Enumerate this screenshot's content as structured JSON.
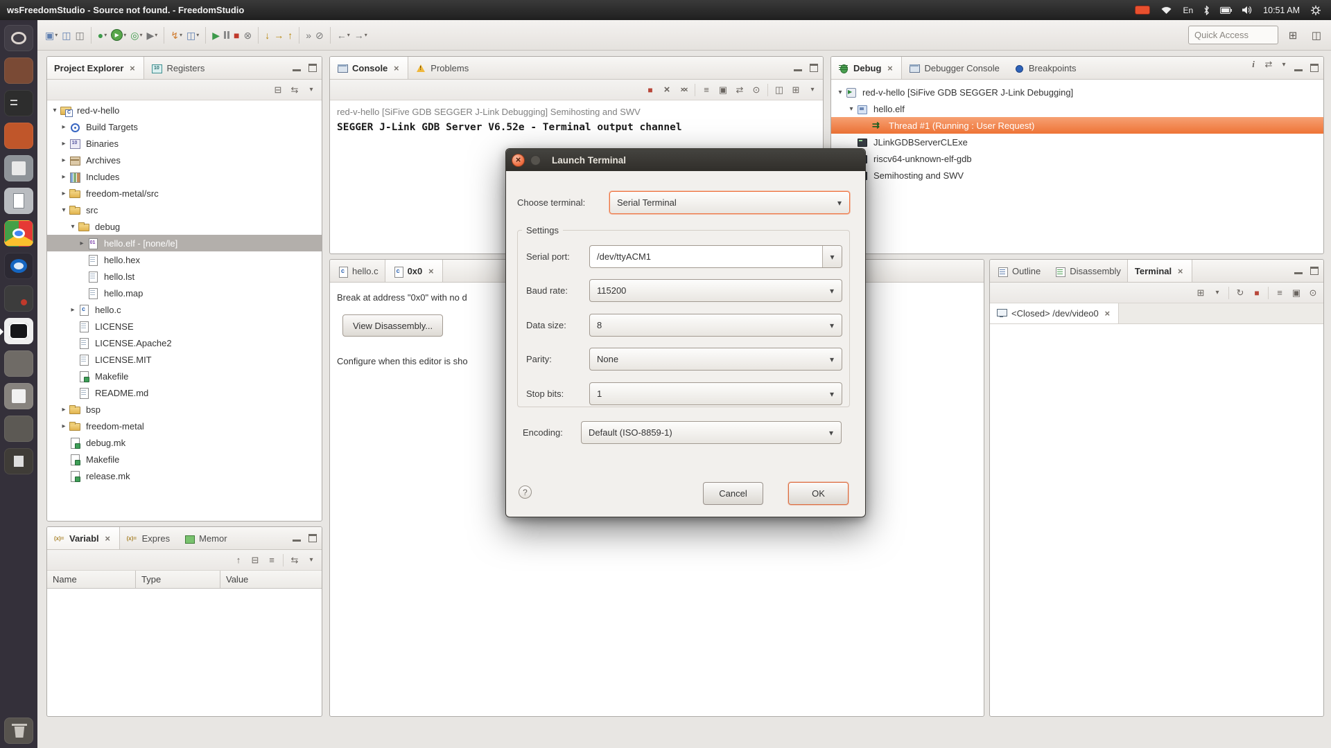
{
  "topbar": {
    "title": "wsFreedomStudio - Source not found. - FreedomStudio",
    "keyboard_indicator": "En",
    "clock": "10:51 AM"
  },
  "toolbar": {
    "quick_access_placeholder": "Quick Access"
  },
  "project_explorer": {
    "tabs": [
      {
        "label": "Project Explorer"
      },
      {
        "label": "Registers"
      }
    ],
    "tree": [
      {
        "label": "red-v-hello",
        "level": 0,
        "icon": "c-project",
        "expanded": true
      },
      {
        "label": "Build Targets",
        "level": 1,
        "icon": "build-targets",
        "expanded": false
      },
      {
        "label": "Binaries",
        "level": 1,
        "icon": "binaries",
        "expanded": false
      },
      {
        "label": "Archives",
        "level": 1,
        "icon": "archives",
        "expanded": false
      },
      {
        "label": "Includes",
        "level": 1,
        "icon": "includes",
        "expanded": false
      },
      {
        "label": "freedom-metal/src",
        "level": 1,
        "icon": "folder",
        "expanded": false
      },
      {
        "label": "src",
        "level": 1,
        "icon": "folder",
        "expanded": true
      },
      {
        "label": "debug",
        "level": 2,
        "icon": "folder",
        "expanded": true
      },
      {
        "label": "hello.elf - [none/le]",
        "level": 3,
        "icon": "elf-binary",
        "selected": true
      },
      {
        "label": "hello.hex",
        "level": 3,
        "icon": "file"
      },
      {
        "label": "hello.lst",
        "level": 3,
        "icon": "file"
      },
      {
        "label": "hello.map",
        "level": 3,
        "icon": "file"
      },
      {
        "label": "hello.c",
        "level": 2,
        "icon": "c-file",
        "expanded": false
      },
      {
        "label": "LICENSE",
        "level": 2,
        "icon": "file"
      },
      {
        "label": "LICENSE.Apache2",
        "level": 2,
        "icon": "file"
      },
      {
        "label": "LICENSE.MIT",
        "level": 2,
        "icon": "file"
      },
      {
        "label": "Makefile",
        "level": 2,
        "icon": "makefile"
      },
      {
        "label": "README.md",
        "level": 2,
        "icon": "file"
      },
      {
        "label": "bsp",
        "level": 1,
        "icon": "folder",
        "expanded": false
      },
      {
        "label": "freedom-metal",
        "level": 1,
        "icon": "folder",
        "expanded": false
      },
      {
        "label": "debug.mk",
        "level": 1,
        "icon": "makefile"
      },
      {
        "label": "Makefile",
        "level": 1,
        "icon": "makefile"
      },
      {
        "label": "release.mk",
        "level": 1,
        "icon": "makefile"
      }
    ]
  },
  "variables": {
    "tabs": [
      {
        "label": "Variabl"
      },
      {
        "label": "Expres"
      },
      {
        "label": "Memor"
      }
    ],
    "columns": [
      "Name",
      "Type",
      "Value"
    ]
  },
  "console": {
    "tabs": [
      {
        "label": "Console"
      },
      {
        "label": "Problems"
      }
    ],
    "header_line": "red-v-hello [SiFive GDB SEGGER J-Link Debugging] Semihosting and SWV",
    "output_line": "SEGGER J-Link GDB Server V6.52e - Terminal output channel"
  },
  "editor": {
    "tabs": [
      {
        "label": "hello.c"
      },
      {
        "label": "0x0"
      }
    ],
    "message": "Break at address \"0x0\" with no d",
    "disassembly_button": "View Disassembly...",
    "note": "Configure when this editor is sho"
  },
  "debug": {
    "tabs": [
      {
        "label": "Debug"
      },
      {
        "label": "Debugger Console"
      },
      {
        "label": "Breakpoints"
      }
    ],
    "tree": [
      {
        "label": "red-v-hello [SiFive GDB SEGGER J-Link Debugging]",
        "level": 0,
        "icon": "launch",
        "expanded": true
      },
      {
        "label": "hello.elf",
        "level": 1,
        "icon": "program",
        "expanded": true
      },
      {
        "label": "Thread #1 (Running : User Request)",
        "level": 2,
        "icon": "thread",
        "selected": true
      },
      {
        "label": "JLinkGDBServerCLExe",
        "level": 1,
        "icon": "process"
      },
      {
        "label": "riscv64-unknown-elf-gdb",
        "level": 1,
        "icon": "process"
      },
      {
        "label": "Semihosting and SWV",
        "level": 1,
        "icon": "process"
      }
    ]
  },
  "right_panel": {
    "tabs": [
      {
        "label": "Outline"
      },
      {
        "label": "Disassembly"
      },
      {
        "label": "Terminal"
      }
    ],
    "terminal_tab": "<Closed> /dev/video0"
  },
  "dialog": {
    "title": "Launch Terminal",
    "choose_label": "Choose terminal:",
    "choose_value": "Serial Terminal",
    "settings_title": "Settings",
    "fields": [
      {
        "label": "Serial port:",
        "value": "/dev/ttyACM1"
      },
      {
        "label": "Baud rate:",
        "value": "115200"
      },
      {
        "label": "Data size:",
        "value": "8"
      },
      {
        "label": "Parity:",
        "value": "None"
      },
      {
        "label": "Stop bits:",
        "value": "1"
      }
    ],
    "encoding_label": "Encoding:",
    "encoding_value": "Default (ISO-8859-1)",
    "help": "?",
    "cancel": "Cancel",
    "ok": "OK"
  },
  "colors": {
    "accent_orange": "#ef7440",
    "selection_orange": "#ee7336",
    "titlebar_dark": "#302e2a"
  }
}
